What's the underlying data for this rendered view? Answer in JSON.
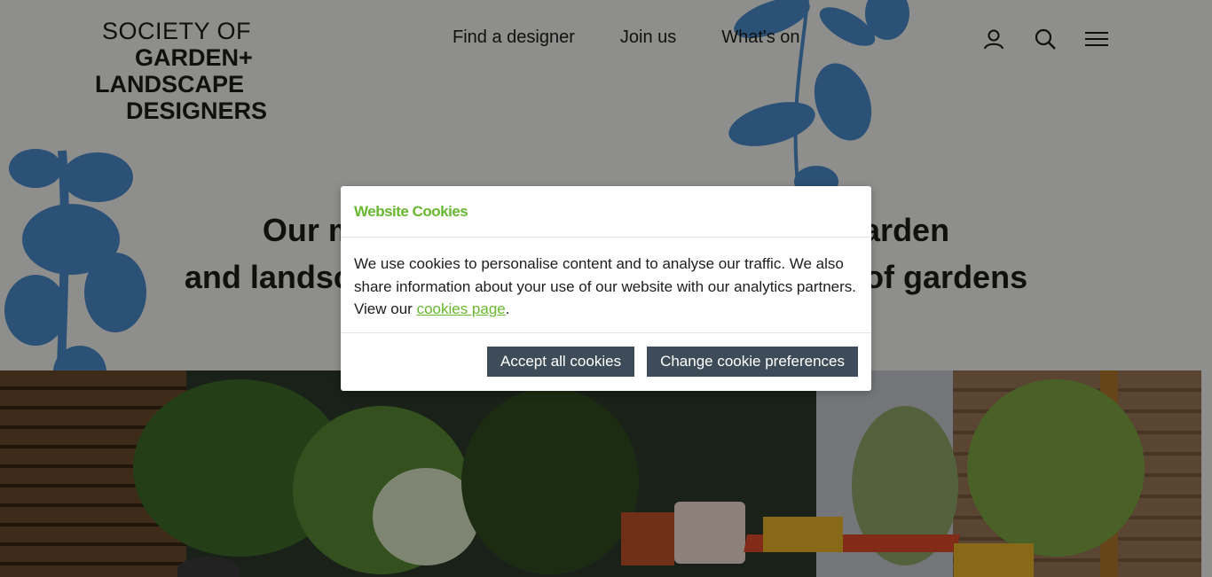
{
  "logo": {
    "line1": "SOCIETY OF",
    "line2": "GARDEN+",
    "line3": "LANDSCAPE",
    "line4": "DESIGNERS"
  },
  "nav": {
    "items": [
      {
        "label": "Find a designer"
      },
      {
        "label": "Join us"
      },
      {
        "label": "What's on"
      }
    ]
  },
  "header_icons": [
    "user-icon",
    "search-icon",
    "menu-icon"
  ],
  "hero": {
    "headline_line1": "Our m                                                         arden",
    "headline_line2": "and landscap                                                  roof gardens"
  },
  "cookie_dialog": {
    "title": "Website Cookies",
    "body_text": "We use cookies to personalise content and to analyse our traffic. We also share information about your use of our website with our analytics partners. View our ",
    "link_text": "cookies page",
    "body_suffix": ".",
    "accept_label": "Accept all cookies",
    "change_label": "Change cookie preferences"
  },
  "colors": {
    "accent_green": "#67b82e",
    "button_bg": "#3d4c58",
    "foliage_blue": "#4a8ccc",
    "page_bg": "#f4f4f2"
  }
}
